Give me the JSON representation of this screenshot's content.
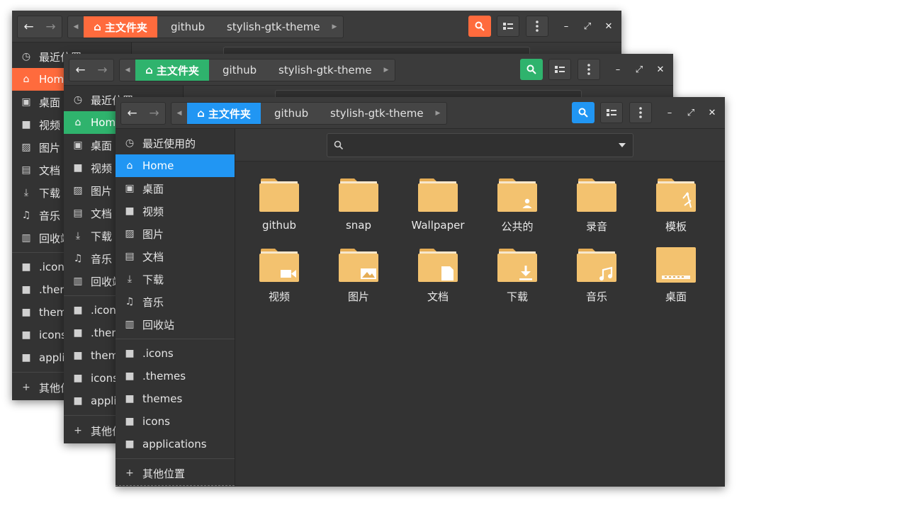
{
  "colors": {
    "orange": "#ff6b3d",
    "green": "#2fb36d",
    "blue": "#2196f3",
    "folder": "#f3c26f",
    "folder_dark": "#e5ad55"
  },
  "nav": {
    "back_icon": "arrow-left-icon",
    "forward_icon": "arrow-right-icon"
  },
  "breadcrumb": {
    "home": "主文件夹",
    "items": [
      "github",
      "stylish-gtk-theme"
    ]
  },
  "sidebar": {
    "places": [
      "最近使用的",
      "Home",
      "桌面",
      "视频",
      "图片",
      "文档",
      "下载",
      "音乐",
      "回收站"
    ],
    "places_icons": [
      "clock-icon",
      "home-icon",
      "desktop-icon",
      "video-icon",
      "image-icon",
      "document-icon",
      "download-icon",
      "music-icon",
      "trash-icon"
    ],
    "bookmarks": [
      ".icons",
      ".themes",
      "themes",
      "icons",
      "applications"
    ],
    "other": "其他位置"
  },
  "back_window_1": {
    "places": [
      "最近位置",
      "Home",
      "桌面",
      "视频",
      "图片",
      "文档",
      "下载",
      "音乐",
      "回收站"
    ],
    "bookmarks": [
      ".icons",
      ".them",
      "them",
      "icons",
      "applic"
    ],
    "other": "其他位"
  },
  "back_window_2": {
    "places": [
      "最近位置",
      "Home",
      "桌面",
      "视频",
      "图片",
      "文档",
      "下载",
      "音乐",
      "回收站"
    ],
    "bookmarks": [
      ".icons",
      ".them",
      "them",
      "icons",
      "applic"
    ],
    "other": "其他位"
  },
  "files": [
    {
      "name": "github",
      "emblem": "none"
    },
    {
      "name": "snap",
      "emblem": "none"
    },
    {
      "name": "Wallpaper",
      "emblem": "none"
    },
    {
      "name": "公共的",
      "emblem": "user"
    },
    {
      "name": "录音",
      "emblem": "none"
    },
    {
      "name": "模板",
      "emblem": "template"
    },
    {
      "name": "视频",
      "emblem": "video"
    },
    {
      "name": "图片",
      "emblem": "image"
    },
    {
      "name": "文档",
      "emblem": "document"
    },
    {
      "name": "下载",
      "emblem": "download"
    },
    {
      "name": "音乐",
      "emblem": "music"
    },
    {
      "name": "桌面",
      "emblem": "desktop"
    }
  ]
}
